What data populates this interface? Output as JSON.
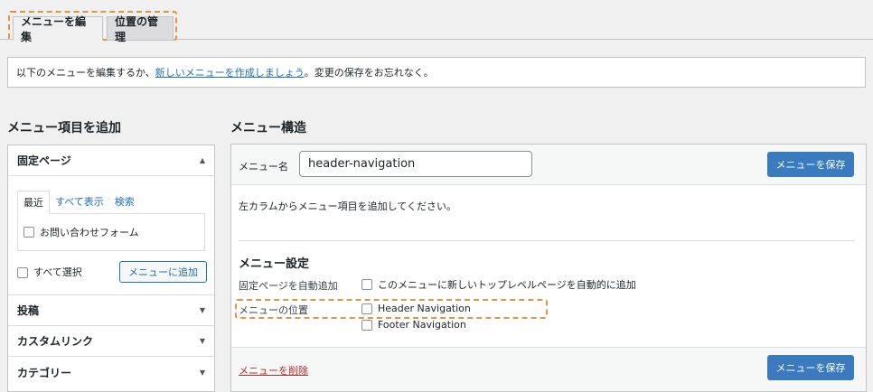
{
  "tabs": [
    {
      "label": "メニューを編集",
      "active": true
    },
    {
      "label": "位置の管理",
      "active": false
    }
  ],
  "notice": {
    "prefix": "以下のメニューを編集するか、",
    "link": "新しいメニューを作成しましょう",
    "suffix": "。変更の保存をお忘れなく。"
  },
  "left": {
    "title": "メニュー項目を追加",
    "pages": {
      "header": "固定ページ",
      "subtabs": [
        "最近",
        "すべて表示",
        "検索"
      ],
      "items": [
        "お問い合わせフォーム"
      ],
      "select_all": "すべて選択",
      "add_button": "メニューに追加"
    },
    "accordions": [
      "投稿",
      "カスタムリンク",
      "カテゴリー"
    ]
  },
  "right": {
    "title": "メニュー構造",
    "name_label": "メニュー名",
    "name_value": "header-navigation",
    "save_button": "メニューを保存",
    "instruction": "左カラムからメニュー項目を追加してください。",
    "settings_title": "メニュー設定",
    "auto_add_label": "固定ページを自動追加",
    "auto_add_option": "このメニューに新しいトップレベルページを自動的に追加",
    "location_label": "メニューの位置",
    "locations": [
      "Header Navigation",
      "Footer Navigation"
    ],
    "delete_link": "メニューを削除"
  }
}
